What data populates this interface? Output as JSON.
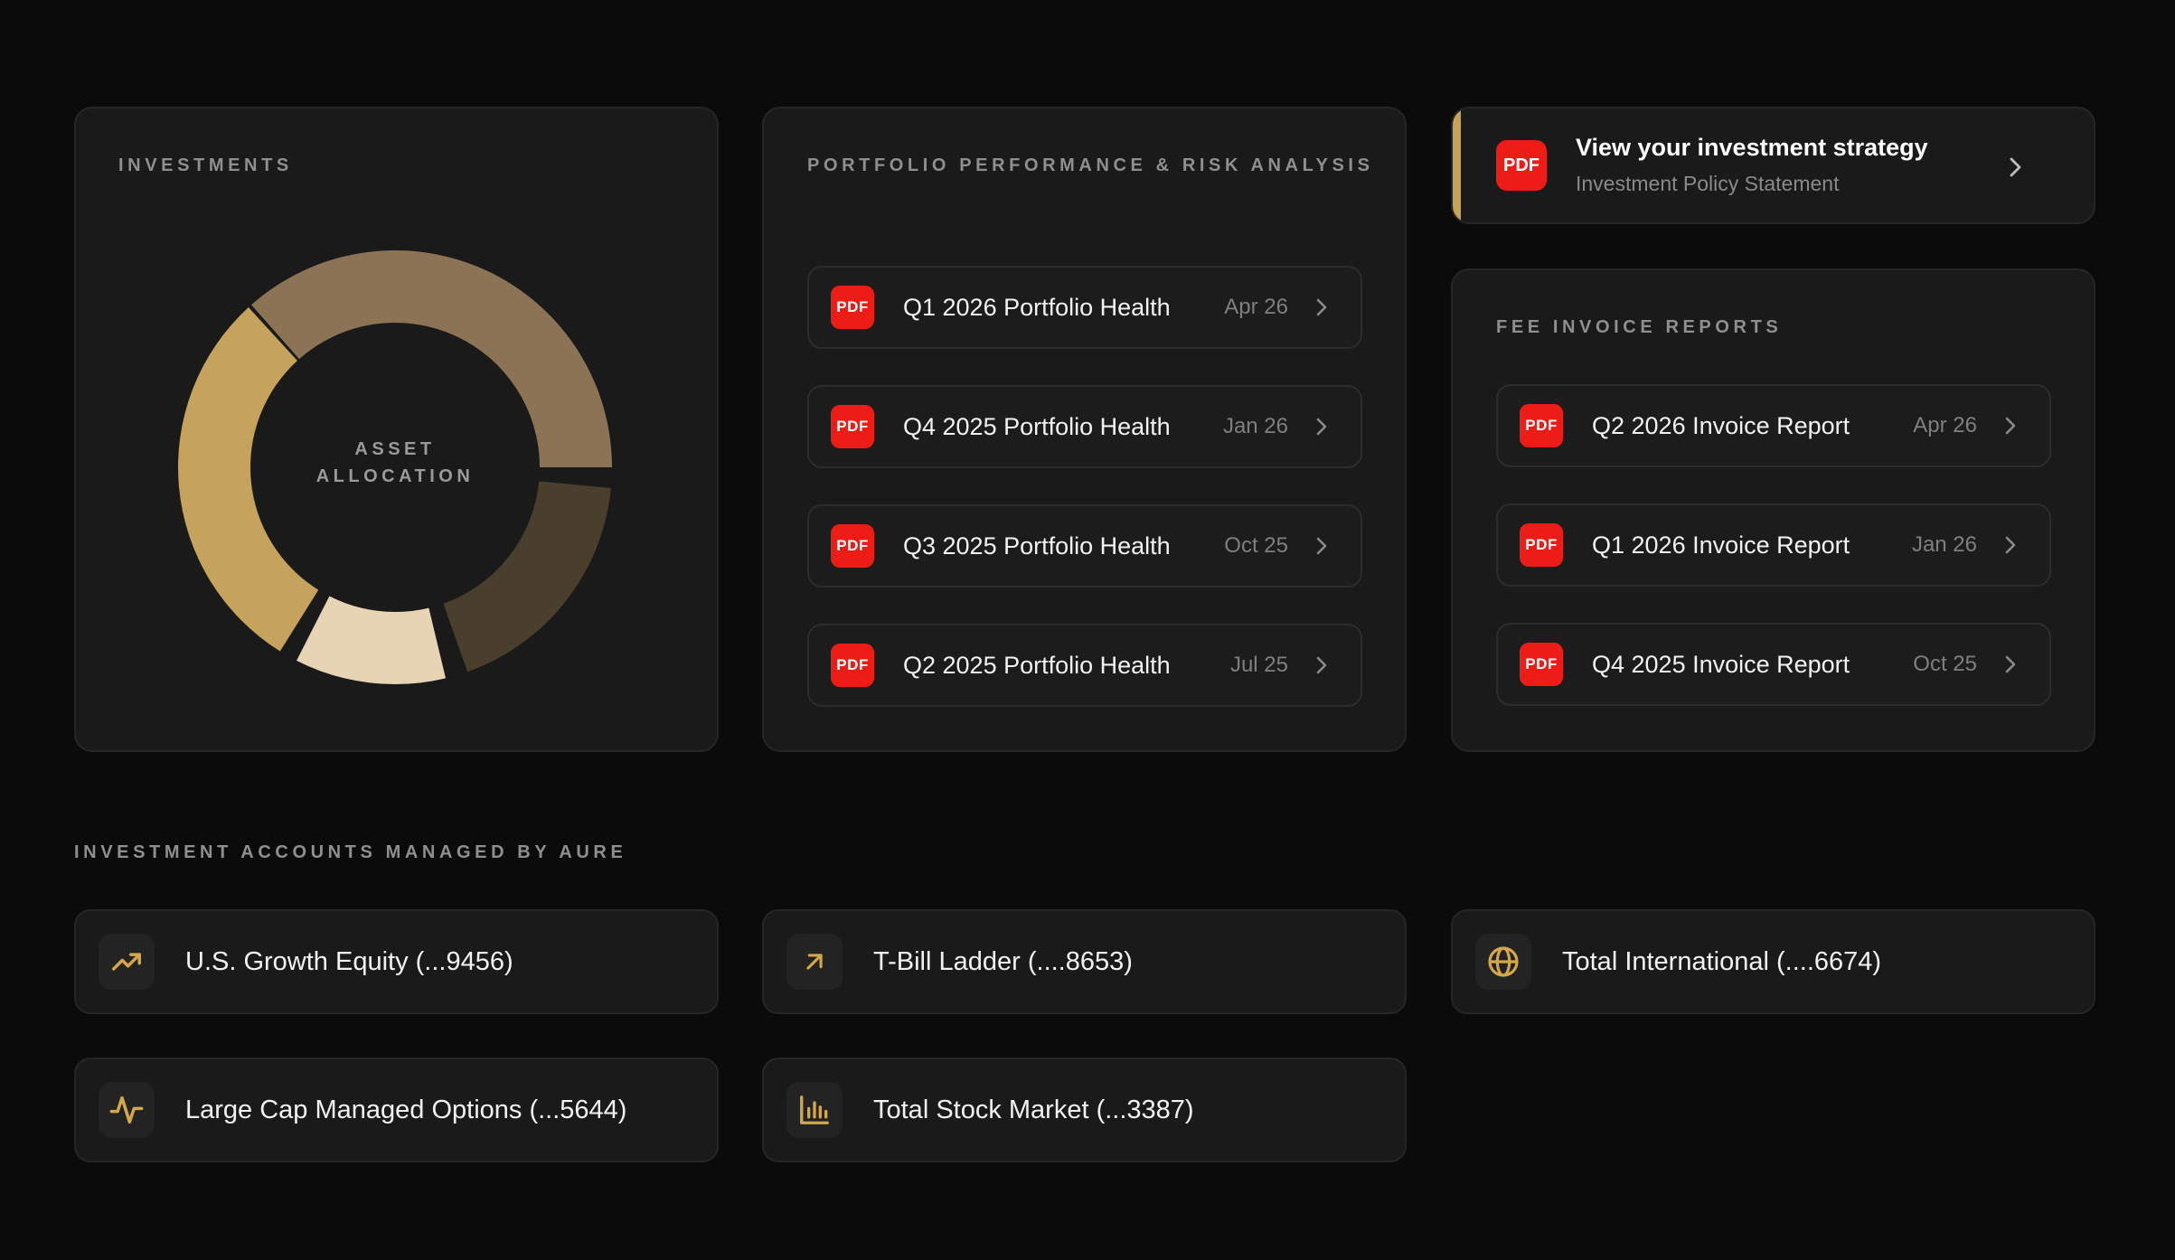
{
  "investments": {
    "label": "INVESTMENTS",
    "center_label_line1": "ASSET",
    "center_label_line2": "ALLOCATION",
    "colors": [
      "#8c7356",
      "#4a3e2c",
      "#e6d4b4",
      "#c6a35c"
    ]
  },
  "portfolio": {
    "label": "PORTFOLIO PERFORMANCE & RISK ANALYSIS",
    "pdf_badge": "PDF",
    "items": [
      {
        "title": "Q1 2026 Portfolio Health",
        "date": "Apr 26"
      },
      {
        "title": "Q4 2025 Portfolio Health",
        "date": "Jan 26"
      },
      {
        "title": "Q3 2025 Portfolio Health",
        "date": "Oct 25"
      },
      {
        "title": "Q2 2025 Portfolio Health",
        "date": "Jul 25"
      }
    ]
  },
  "strategy": {
    "pdf_badge": "PDF",
    "title": "View your investment strategy",
    "subtitle": "Investment Policy Statement",
    "accent_color": "#c8a355"
  },
  "fees": {
    "label": "FEE INVOICE REPORTS",
    "pdf_badge": "PDF",
    "items": [
      {
        "title": "Q2 2026 Invoice Report",
        "date": "Apr 26"
      },
      {
        "title": "Q1 2026 Invoice Report",
        "date": "Jan 26"
      },
      {
        "title": "Q4 2025 Invoice Report",
        "date": "Oct 25"
      }
    ]
  },
  "accounts": {
    "label": "INVESTMENT ACCOUNTS MANAGED BY AURE",
    "icon_color": "#d4a84a",
    "items": [
      {
        "name": "U.S. Growth Equity (...9456)",
        "icon": "trending-up-icon"
      },
      {
        "name": "T-Bill Ladder (....8653)",
        "icon": "arrow-up-right-icon"
      },
      {
        "name": "Total International (....6674)",
        "icon": "globe-icon"
      },
      {
        "name": "Large Cap Managed Options (...5644)",
        "icon": "activity-icon"
      },
      {
        "name": "Total Stock Market (...3387)",
        "icon": "bar-chart-icon"
      }
    ]
  }
}
